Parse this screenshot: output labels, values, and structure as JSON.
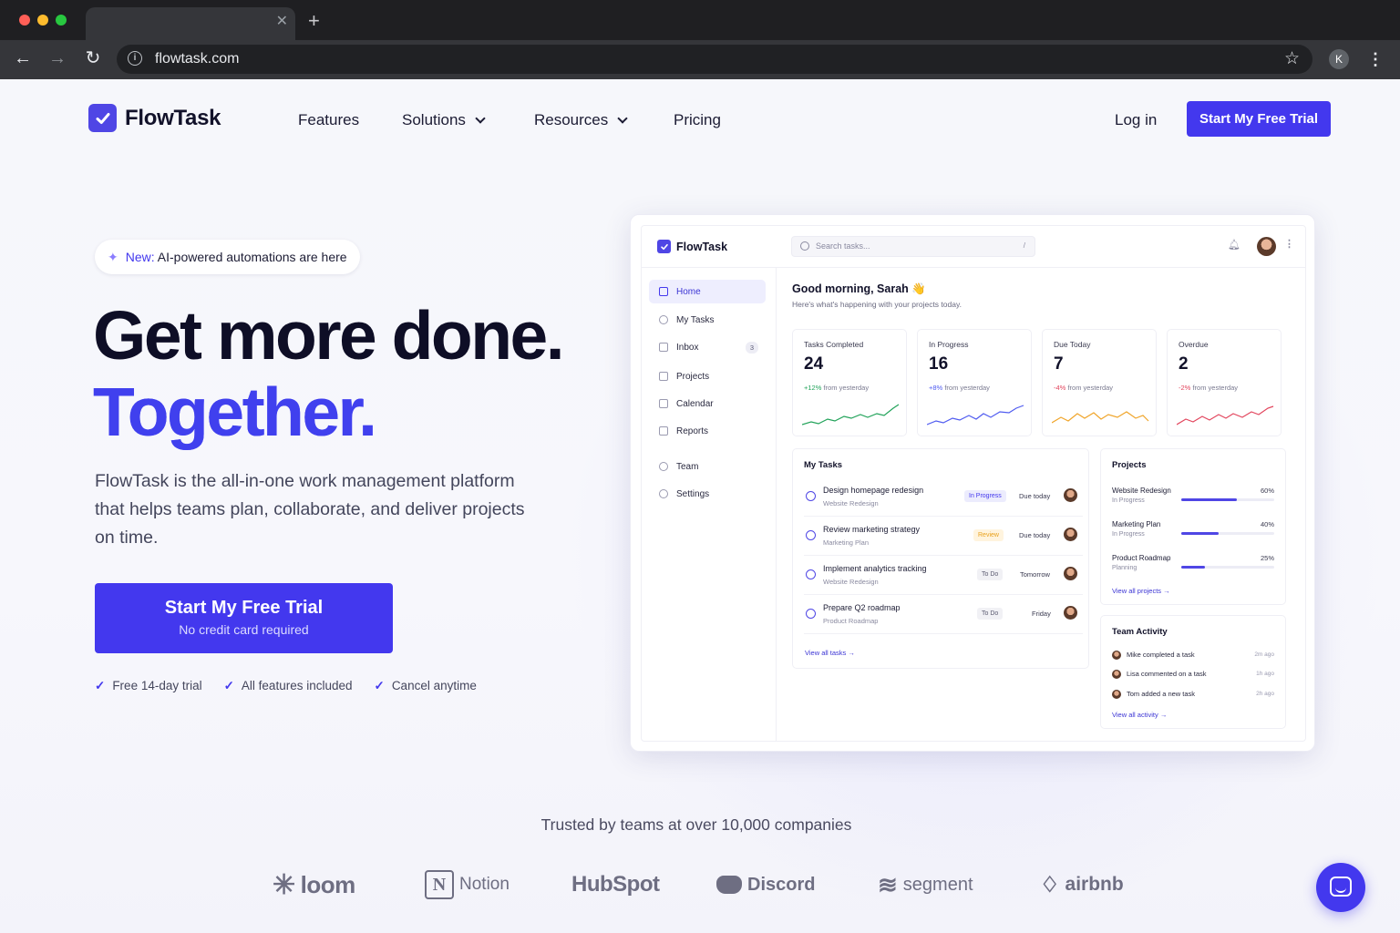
{
  "browser": {
    "url": "flowtask.com",
    "profile_initial": "K"
  },
  "nav": {
    "brand": "FlowTask",
    "links": [
      "Features",
      "Solutions",
      "Resources",
      "Pricing"
    ],
    "login": "Log in",
    "cta": "Start My Free Trial"
  },
  "hero": {
    "badge_new": "New:",
    "badge_text": "AI-powered automations are here",
    "headline_1": "Get more done.",
    "headline_2": "Together.",
    "lead": "FlowTask is the all-in-one work management platform that helps teams plan, collaborate, and deliver projects on time.",
    "cta_title": "Start My Free Trial",
    "cta_sub": "No credit card required",
    "checks": [
      "Free 14-day trial",
      "All features included",
      "Cancel anytime"
    ]
  },
  "app": {
    "brand": "FlowTask",
    "search_placeholder": "Search tasks...",
    "search_shortcut": "/",
    "sidebar": [
      {
        "label": "Home",
        "active": true
      },
      {
        "label": "My Tasks"
      },
      {
        "label": "Inbox",
        "count": "3"
      },
      {
        "label": "Projects"
      },
      {
        "label": "Calendar"
      },
      {
        "label": "Reports"
      },
      {
        "label": "Team"
      },
      {
        "label": "Settings"
      }
    ],
    "greeting": "Good morning, Sarah 👋",
    "greeting_sub": "Here's what's happening with your projects today.",
    "stats": [
      {
        "label": "Tasks Completed",
        "value": "24",
        "change": "+12%",
        "change_suffix": "from yesterday",
        "color": "#22a35a"
      },
      {
        "label": "In Progress",
        "value": "16",
        "change": "+8%",
        "change_suffix": "from yesterday",
        "color": "#4f5bf0"
      },
      {
        "label": "Due Today",
        "value": "7",
        "change": "-4%",
        "change_suffix": "from yesterday",
        "color": "#f0a52a"
      },
      {
        "label": "Overdue",
        "value": "2",
        "change": "-2%",
        "change_suffix": "from yesterday",
        "color": "#e2445c"
      }
    ],
    "my_tasks_title": "My Tasks",
    "tasks": [
      {
        "title": "Design homepage redesign",
        "project": "Website Redesign",
        "status": "In Progress",
        "due": "Due today"
      },
      {
        "title": "Review marketing strategy",
        "project": "Marketing Plan",
        "status": "Review",
        "due": "Due today"
      },
      {
        "title": "Implement analytics tracking",
        "project": "Website Redesign",
        "status": "To Do",
        "due": "Tomorrow"
      },
      {
        "title": "Prepare Q2 roadmap",
        "project": "Product Roadmap",
        "status": "To Do",
        "due": "Friday"
      }
    ],
    "view_all_tasks": "View all tasks",
    "projects_title": "Projects",
    "projects": [
      {
        "name": "Website Redesign",
        "status": "In Progress",
        "percent": "60%",
        "progress": 0.6
      },
      {
        "name": "Marketing Plan",
        "status": "In Progress",
        "percent": "40%",
        "progress": 0.4
      },
      {
        "name": "Product Roadmap",
        "status": "Planning",
        "percent": "25%",
        "progress": 0.25
      }
    ],
    "view_all_projects": "View all projects",
    "activity_title": "Team Activity",
    "activity": [
      {
        "text": "Mike completed a task",
        "time": "2m ago"
      },
      {
        "text": "Lisa commented on a task",
        "time": "1h ago"
      },
      {
        "text": "Tom added a new task",
        "time": "2h ago"
      }
    ],
    "view_all_activity": "View all activity"
  },
  "trusted": "Trusted by teams at over 10,000 companies",
  "logos": [
    "loom",
    "Notion",
    "HubSpot",
    "Discord",
    "segment",
    "airbnb"
  ]
}
